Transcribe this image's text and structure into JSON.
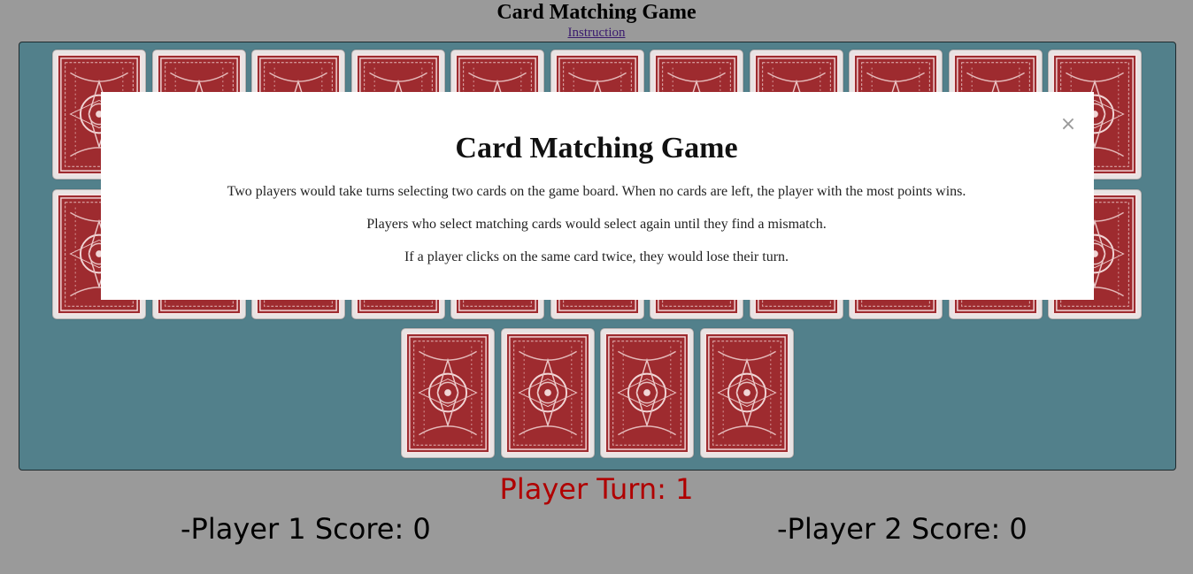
{
  "header": {
    "title": "Card Matching Game",
    "instruction_link": "Instruction"
  },
  "board": {
    "card_back_color": "#9e2b2f",
    "board_color": "#52808b",
    "card_count": 26
  },
  "modal": {
    "title": "Card Matching Game",
    "close_symbol": "×",
    "paragraphs": [
      "Two players would take turns selecting two cards on the game board. When no cards are left, the player with the most points wins.",
      "Players who select matching cards would select again until they find a mismatch.",
      "If a player clicks on the same card twice, they would lose their turn."
    ]
  },
  "status": {
    "turn_label": "Player Turn: 1",
    "player1_score": "-Player 1 Score: 0",
    "player2_score": "-Player 2 Score: 0",
    "turn_color": "#b00000"
  }
}
